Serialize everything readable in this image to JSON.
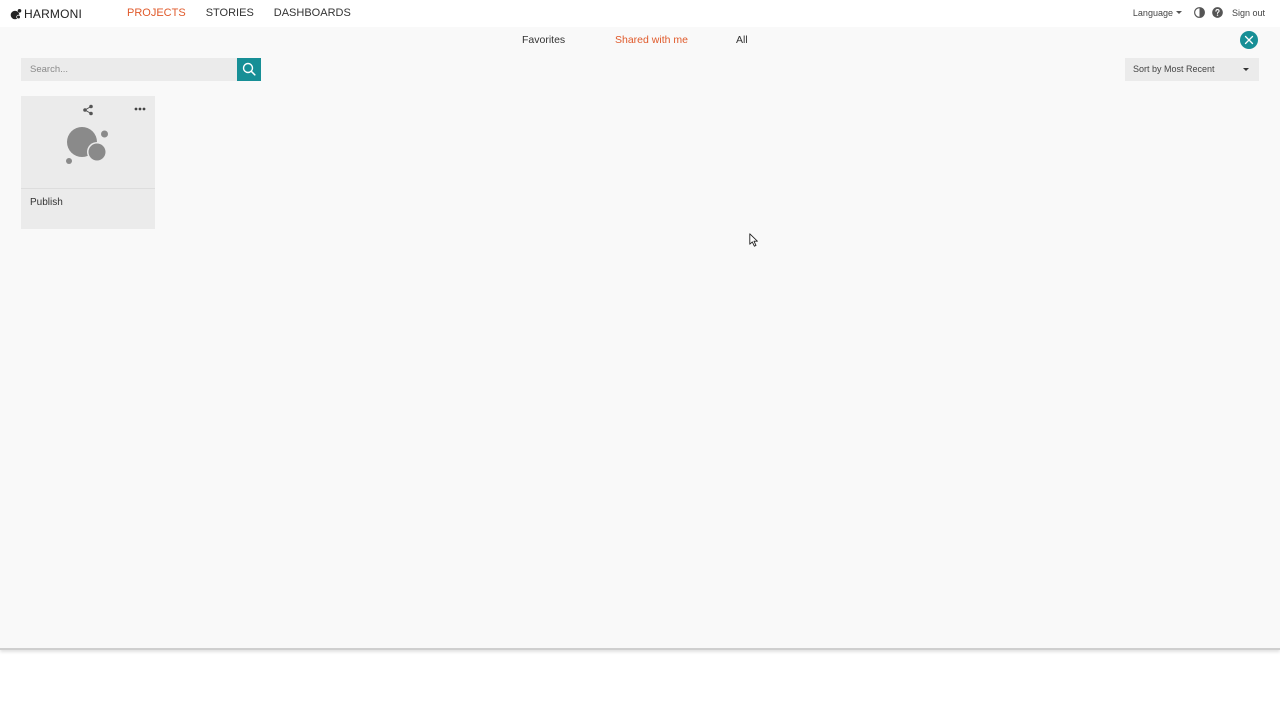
{
  "header": {
    "brand": "HARMONI",
    "nav": [
      {
        "label": "PROJECTS",
        "active": true
      },
      {
        "label": "STORIES",
        "active": false
      },
      {
        "label": "DASHBOARDS",
        "active": false
      }
    ],
    "language_label": "Language",
    "signout_label": "Sign out",
    "icons": [
      "contrast-icon",
      "help-icon"
    ]
  },
  "filters": {
    "tabs": [
      {
        "label": "Favorites",
        "active": false
      },
      {
        "label": "Shared with me",
        "active": true
      },
      {
        "label": "All",
        "active": false
      }
    ]
  },
  "toolbar": {
    "search_placeholder": "Search...",
    "sort_label": "Sort by Most Recent"
  },
  "projects": [
    {
      "title": "Publish"
    }
  ],
  "colors": {
    "accent": "#e05a2b",
    "teal": "#178f96",
    "background": "#f9f9f9",
    "card": "#ebebeb"
  }
}
